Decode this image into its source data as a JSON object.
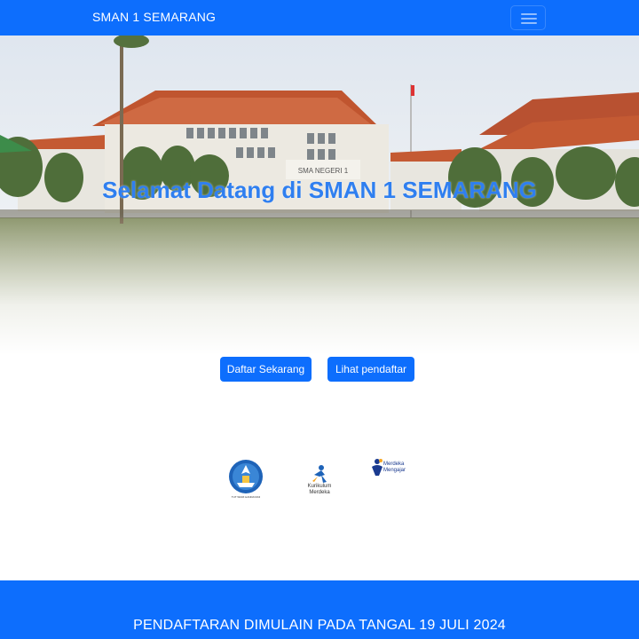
{
  "navbar": {
    "brand": "SMAN 1 SEMARANG",
    "toggler_icon": "hamburger-icon"
  },
  "hero": {
    "title": "Selamat Datang di SMAN 1 SEMARANG",
    "building_sign": "SMA NEGERI 1"
  },
  "actions": {
    "register_label": "Daftar Sekarang",
    "view_registrants_label": "Lihat pendaftar"
  },
  "logos": [
    {
      "icon": "tut-wuri-handayani-logo",
      "caption": "TUT WURI HANDAYANI"
    },
    {
      "icon": "kurikulum-merdeka-logo",
      "caption_line1": "Kurikulum",
      "caption_line2": "Merdeka"
    },
    {
      "icon": "merdeka-mengajar-logo",
      "caption_line1": "Merdeka",
      "caption_line2": "Mengajar"
    }
  ],
  "footer": {
    "announcement": "PENDAFTARAN DIMULAIN PADA TANGAL 19 JULI 2024"
  },
  "colors": {
    "primary": "#0d6efd",
    "hero_title": "#2f7ff0",
    "roof": "#c0552f",
    "lawn": "#8f9a6a"
  }
}
